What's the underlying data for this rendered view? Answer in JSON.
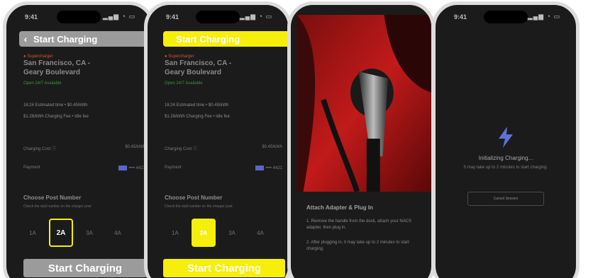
{
  "status_bar": {
    "time": "9:41",
    "icons": "▂▄▆ ◔ ▭"
  },
  "screen1": {
    "title": "Start Charging",
    "station_tag": "● Supercharger",
    "address_line1": "San Francisco, CA -",
    "address_line2": "Geary Boulevard",
    "availability": "Open 24/7 Available",
    "info1": "16:24 Estimated time • $0.45/kWh",
    "info2": "$1.28/kWh Charging Fee • Idle fee",
    "row_charging_label": "Charging Cost ⓘ",
    "row_charging_value": "$0.45/kWh",
    "row_payment_label": "Payment",
    "row_payment_value": "•••• 4421",
    "ports_title": "Choose Post Number",
    "ports_subtitle": "Check the stall number on the charger post",
    "ports": [
      "1A",
      "2A",
      "3A",
      "4A"
    ],
    "selected_port": "2A",
    "cta": "Start Charging"
  },
  "screen2": {
    "title": "Start Charging",
    "station_tag": "● Supercharger",
    "address_line1": "San Francisco, CA -",
    "address_line2": "Geary Boulevard",
    "availability": "Open 24/7 Available",
    "info1": "16:24 Estimated time • $0.45/kWh",
    "info2": "$1.28/kWh Charging Fee • Idle fee",
    "row_charging_label": "Charging Cost ⓘ",
    "row_charging_value": "$0.45/kWh",
    "row_payment_label": "Payment",
    "row_payment_value": "•••• 4421",
    "ports_title": "Choose Post Number",
    "ports_subtitle": "Check the stall number on the charger post",
    "ports": [
      "1A",
      "2A",
      "3A",
      "4A"
    ],
    "selected_port": "2A",
    "cta": "Start Charging"
  },
  "screen3": {
    "step_title": "Attach Adapter & Plug In",
    "step1": "1. Remove the handle from the dock, attach your NACS adapter, then plug in.",
    "step2": "2. After plugging in, it may take up to 2 minutes to start charging."
  },
  "screen4": {
    "title": "Initializing Charging...",
    "subtitle": "It may take up to 2 minutes to start charging.",
    "cancel": "Cancel Session"
  },
  "colors": {
    "accent": "#f6ee0b",
    "disabled": "#9b9b9b",
    "background": "#1b1b1b"
  }
}
